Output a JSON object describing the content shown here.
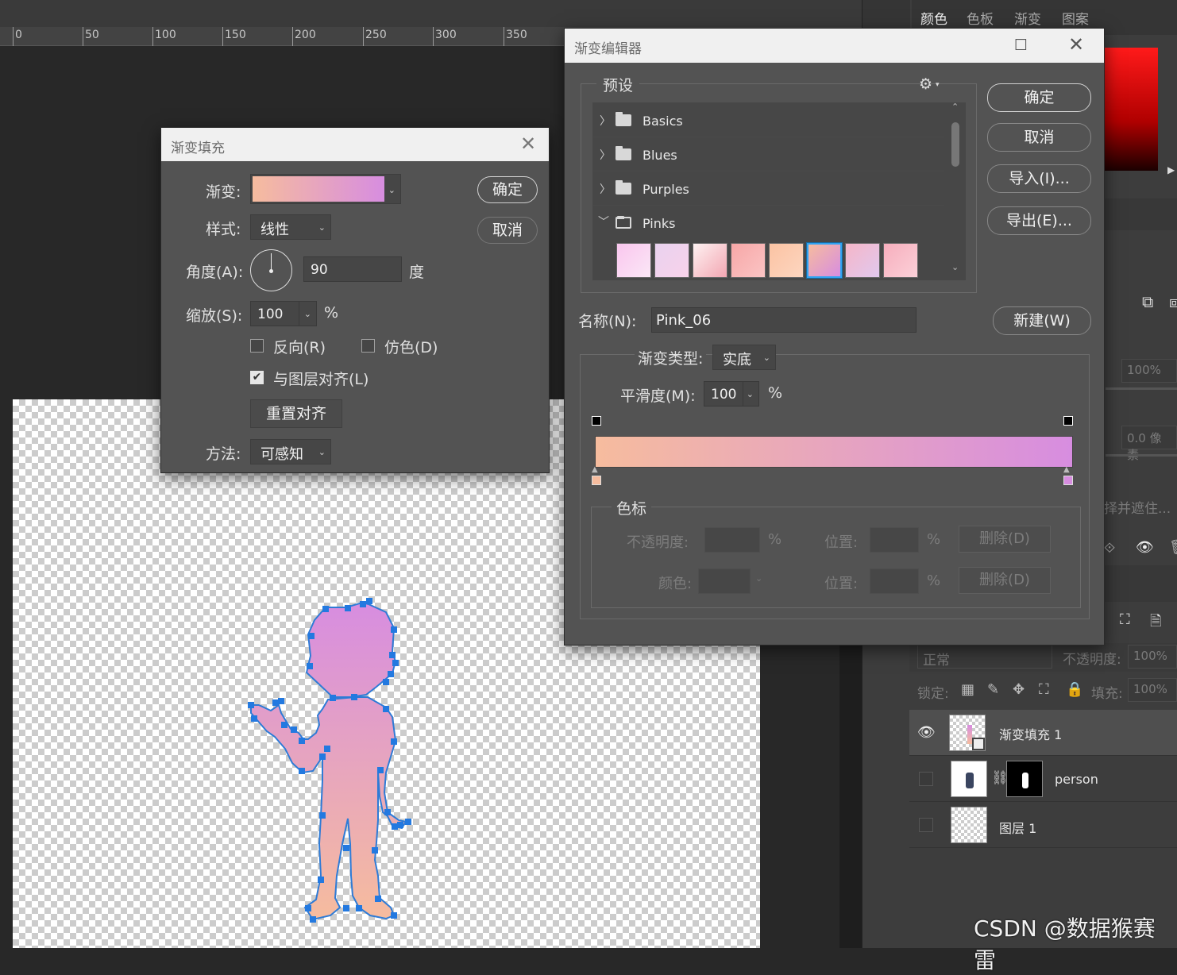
{
  "ruler": {
    "ticks": [
      "0",
      "50",
      "100",
      "150",
      "200",
      "250",
      "300",
      "350"
    ]
  },
  "right_panel": {
    "tabs": [
      "颜色",
      "色板",
      "渐变",
      "图案"
    ],
    "opacity_value_1": "100%",
    "feather_value": "0.0 像素",
    "mask_text": "择并遮住...",
    "blend_mode": "正常",
    "opacity_label": "不透明度:",
    "opacity_value": "100%",
    "lock_label": "锁定:",
    "fill_label": "填充:",
    "fill_value": "100%",
    "layers": [
      {
        "name": "渐变填充 1",
        "visible": true,
        "selected": true
      },
      {
        "name": "person",
        "visible": false,
        "selected": false
      },
      {
        "name": "图层 1",
        "visible": false,
        "selected": false
      }
    ]
  },
  "fill_dialog": {
    "title": "渐变填充",
    "gradient_label": "渐变:",
    "style_label": "样式:",
    "style_value": "线性",
    "angle_label": "角度(A):",
    "angle_value": "90",
    "angle_unit": "度",
    "scale_label": "缩放(S):",
    "scale_value": "100",
    "scale_unit": "%",
    "reverse_label": "反向(R)",
    "reverse_checked": false,
    "dither_label": "仿色(D)",
    "dither_checked": false,
    "align_label": "与图层对齐(L)",
    "align_checked": true,
    "reset_align_label": "重置对齐",
    "method_label": "方法:",
    "method_value": "可感知",
    "ok_label": "确定",
    "cancel_label": "取消",
    "gradient_colors": [
      "#f6bc9e",
      "#d78de0"
    ]
  },
  "editor": {
    "title": "渐变编辑器",
    "presets_label": "预设",
    "preset_folders": [
      {
        "name": "Basics",
        "expanded": false
      },
      {
        "name": "Blues",
        "expanded": false
      },
      {
        "name": "Purples",
        "expanded": false
      },
      {
        "name": "Pinks",
        "expanded": true
      }
    ],
    "swatches": [
      [
        "#f9c6ee",
        "#fbe7f6"
      ],
      [
        "#e9d2ef",
        "#f8d2ea"
      ],
      [
        "#fef2f2",
        "#f3a6b2"
      ],
      [
        "#f7a7a7",
        "#fbc4c4"
      ],
      [
        "#fbc3a3",
        "#fdd6c0"
      ],
      [
        "#f6bc9e",
        "#d78de0"
      ],
      [
        "#f5b6c8",
        "#e1c8ee"
      ],
      [
        "#f7aebd",
        "#fbd0d8"
      ]
    ],
    "selected_swatch": 5,
    "ok_label": "确定",
    "cancel_label": "取消",
    "import_label": "导入(I)...",
    "export_label": "导出(E)...",
    "name_label": "名称(N):",
    "name_value": "Pink_06",
    "new_label": "新建(W)",
    "type_label": "渐变类型:",
    "type_value": "实底",
    "smooth_label": "平滑度(M):",
    "smooth_value": "100",
    "smooth_unit": "%",
    "stops_section_label": "色标",
    "opacity_label": "不透明度:",
    "opacity_unit": "%",
    "location_label": "位置:",
    "location_unit": "%",
    "color_label": "颜色:",
    "delete_label": "删除(D)",
    "gradient_colors": [
      "#f6bc9e",
      "#d78de0"
    ]
  },
  "watermark": "CSDN @数据猴赛雷"
}
